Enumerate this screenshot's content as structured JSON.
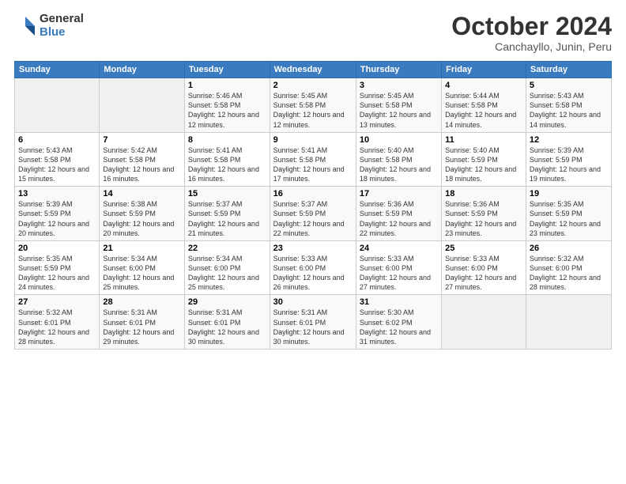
{
  "logo": {
    "general": "General",
    "blue": "Blue"
  },
  "title": "October 2024",
  "location": "Canchayllo, Junin, Peru",
  "days_of_week": [
    "Sunday",
    "Monday",
    "Tuesday",
    "Wednesday",
    "Thursday",
    "Friday",
    "Saturday"
  ],
  "weeks": [
    [
      {
        "day": "",
        "sunrise": "",
        "sunset": "",
        "daylight": ""
      },
      {
        "day": "",
        "sunrise": "",
        "sunset": "",
        "daylight": ""
      },
      {
        "day": "1",
        "sunrise": "Sunrise: 5:46 AM",
        "sunset": "Sunset: 5:58 PM",
        "daylight": "Daylight: 12 hours and 12 minutes."
      },
      {
        "day": "2",
        "sunrise": "Sunrise: 5:45 AM",
        "sunset": "Sunset: 5:58 PM",
        "daylight": "Daylight: 12 hours and 12 minutes."
      },
      {
        "day": "3",
        "sunrise": "Sunrise: 5:45 AM",
        "sunset": "Sunset: 5:58 PM",
        "daylight": "Daylight: 12 hours and 13 minutes."
      },
      {
        "day": "4",
        "sunrise": "Sunrise: 5:44 AM",
        "sunset": "Sunset: 5:58 PM",
        "daylight": "Daylight: 12 hours and 14 minutes."
      },
      {
        "day": "5",
        "sunrise": "Sunrise: 5:43 AM",
        "sunset": "Sunset: 5:58 PM",
        "daylight": "Daylight: 12 hours and 14 minutes."
      }
    ],
    [
      {
        "day": "6",
        "sunrise": "Sunrise: 5:43 AM",
        "sunset": "Sunset: 5:58 PM",
        "daylight": "Daylight: 12 hours and 15 minutes."
      },
      {
        "day": "7",
        "sunrise": "Sunrise: 5:42 AM",
        "sunset": "Sunset: 5:58 PM",
        "daylight": "Daylight: 12 hours and 16 minutes."
      },
      {
        "day": "8",
        "sunrise": "Sunrise: 5:41 AM",
        "sunset": "Sunset: 5:58 PM",
        "daylight": "Daylight: 12 hours and 16 minutes."
      },
      {
        "day": "9",
        "sunrise": "Sunrise: 5:41 AM",
        "sunset": "Sunset: 5:58 PM",
        "daylight": "Daylight: 12 hours and 17 minutes."
      },
      {
        "day": "10",
        "sunrise": "Sunrise: 5:40 AM",
        "sunset": "Sunset: 5:58 PM",
        "daylight": "Daylight: 12 hours and 18 minutes."
      },
      {
        "day": "11",
        "sunrise": "Sunrise: 5:40 AM",
        "sunset": "Sunset: 5:59 PM",
        "daylight": "Daylight: 12 hours and 18 minutes."
      },
      {
        "day": "12",
        "sunrise": "Sunrise: 5:39 AM",
        "sunset": "Sunset: 5:59 PM",
        "daylight": "Daylight: 12 hours and 19 minutes."
      }
    ],
    [
      {
        "day": "13",
        "sunrise": "Sunrise: 5:39 AM",
        "sunset": "Sunset: 5:59 PM",
        "daylight": "Daylight: 12 hours and 20 minutes."
      },
      {
        "day": "14",
        "sunrise": "Sunrise: 5:38 AM",
        "sunset": "Sunset: 5:59 PM",
        "daylight": "Daylight: 12 hours and 20 minutes."
      },
      {
        "day": "15",
        "sunrise": "Sunrise: 5:37 AM",
        "sunset": "Sunset: 5:59 PM",
        "daylight": "Daylight: 12 hours and 21 minutes."
      },
      {
        "day": "16",
        "sunrise": "Sunrise: 5:37 AM",
        "sunset": "Sunset: 5:59 PM",
        "daylight": "Daylight: 12 hours and 22 minutes."
      },
      {
        "day": "17",
        "sunrise": "Sunrise: 5:36 AM",
        "sunset": "Sunset: 5:59 PM",
        "daylight": "Daylight: 12 hours and 22 minutes."
      },
      {
        "day": "18",
        "sunrise": "Sunrise: 5:36 AM",
        "sunset": "Sunset: 5:59 PM",
        "daylight": "Daylight: 12 hours and 23 minutes."
      },
      {
        "day": "19",
        "sunrise": "Sunrise: 5:35 AM",
        "sunset": "Sunset: 5:59 PM",
        "daylight": "Daylight: 12 hours and 23 minutes."
      }
    ],
    [
      {
        "day": "20",
        "sunrise": "Sunrise: 5:35 AM",
        "sunset": "Sunset: 5:59 PM",
        "daylight": "Daylight: 12 hours and 24 minutes."
      },
      {
        "day": "21",
        "sunrise": "Sunrise: 5:34 AM",
        "sunset": "Sunset: 6:00 PM",
        "daylight": "Daylight: 12 hours and 25 minutes."
      },
      {
        "day": "22",
        "sunrise": "Sunrise: 5:34 AM",
        "sunset": "Sunset: 6:00 PM",
        "daylight": "Daylight: 12 hours and 25 minutes."
      },
      {
        "day": "23",
        "sunrise": "Sunrise: 5:33 AM",
        "sunset": "Sunset: 6:00 PM",
        "daylight": "Daylight: 12 hours and 26 minutes."
      },
      {
        "day": "24",
        "sunrise": "Sunrise: 5:33 AM",
        "sunset": "Sunset: 6:00 PM",
        "daylight": "Daylight: 12 hours and 27 minutes."
      },
      {
        "day": "25",
        "sunrise": "Sunrise: 5:33 AM",
        "sunset": "Sunset: 6:00 PM",
        "daylight": "Daylight: 12 hours and 27 minutes."
      },
      {
        "day": "26",
        "sunrise": "Sunrise: 5:32 AM",
        "sunset": "Sunset: 6:00 PM",
        "daylight": "Daylight: 12 hours and 28 minutes."
      }
    ],
    [
      {
        "day": "27",
        "sunrise": "Sunrise: 5:32 AM",
        "sunset": "Sunset: 6:01 PM",
        "daylight": "Daylight: 12 hours and 28 minutes."
      },
      {
        "day": "28",
        "sunrise": "Sunrise: 5:31 AM",
        "sunset": "Sunset: 6:01 PM",
        "daylight": "Daylight: 12 hours and 29 minutes."
      },
      {
        "day": "29",
        "sunrise": "Sunrise: 5:31 AM",
        "sunset": "Sunset: 6:01 PM",
        "daylight": "Daylight: 12 hours and 30 minutes."
      },
      {
        "day": "30",
        "sunrise": "Sunrise: 5:31 AM",
        "sunset": "Sunset: 6:01 PM",
        "daylight": "Daylight: 12 hours and 30 minutes."
      },
      {
        "day": "31",
        "sunrise": "Sunrise: 5:30 AM",
        "sunset": "Sunset: 6:02 PM",
        "daylight": "Daylight: 12 hours and 31 minutes."
      },
      {
        "day": "",
        "sunrise": "",
        "sunset": "",
        "daylight": ""
      },
      {
        "day": "",
        "sunrise": "",
        "sunset": "",
        "daylight": ""
      }
    ]
  ]
}
